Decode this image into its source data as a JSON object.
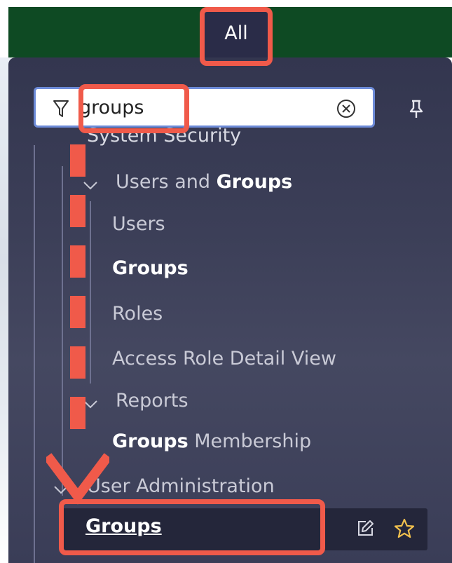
{
  "topbar": {
    "all_tab_label": "All"
  },
  "filter": {
    "value": "groups"
  },
  "tree": {
    "system_security": "System Security",
    "users_and_groups_prefix": "Users and ",
    "users_and_groups_bold": "Groups",
    "users": "Users",
    "groups": "Groups",
    "roles": "Roles",
    "access_role_detail_view": "Access Role Detail View",
    "reports": "Reports",
    "groups_membership_bold": "Groups",
    "groups_membership_rest": " Membership",
    "user_administration": "User Administration",
    "selected_item": "Groups"
  },
  "colors": {
    "topbar_green": "#0e4a23",
    "menu_bg": "#3c3f58",
    "highlight_red": "#f05a4a",
    "focus_blue": "#6d8bd8"
  }
}
